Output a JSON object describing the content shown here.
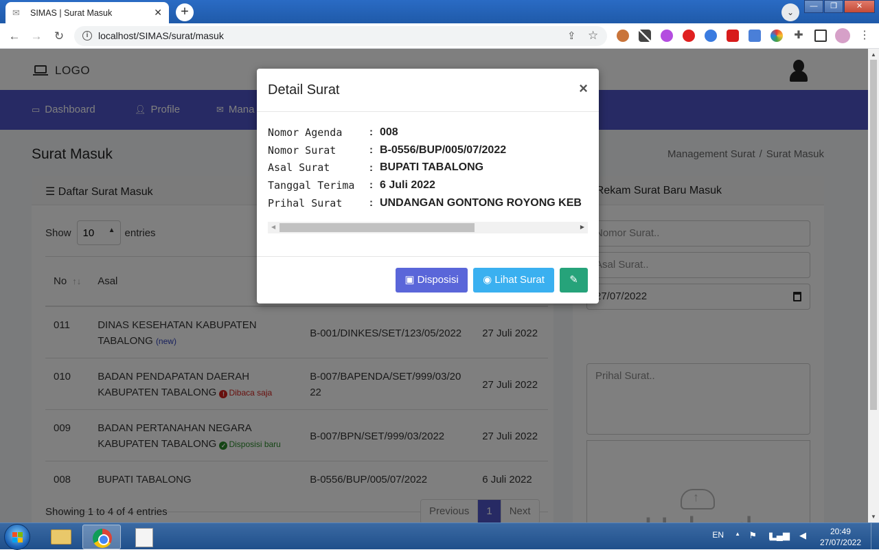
{
  "browser": {
    "tab_title": "SIMAS | Surat Masuk",
    "url": "localhost/SIMAS/surat/masuk",
    "new_tab_symbol": "+",
    "close_symbol": "✕"
  },
  "header": {
    "logo_text": "LOGO"
  },
  "nav": {
    "items": [
      {
        "label": "Dashboard",
        "icon": "monitor-icon"
      },
      {
        "label": "Profile",
        "icon": "user-icon"
      },
      {
        "label": "Mana",
        "icon": "mail-icon"
      }
    ]
  },
  "content": {
    "title": "Surat Masuk",
    "breadcrumb": [
      "Management Surat",
      "Surat Masuk"
    ]
  },
  "list_card": {
    "title": "Daftar Surat Masuk",
    "show_label": "Show",
    "entries_label": "entries",
    "page_size": "10",
    "columns": [
      "No",
      "Asal"
    ],
    "rows": [
      {
        "no": "011",
        "asal": "DINAS KESEHATAN KABUPATEN TABALONG",
        "badge": "(new)",
        "badge_type": "new",
        "nomor": "B-001/DINKES/SET/123/05/2022",
        "tanggal": "27 Juli 2022"
      },
      {
        "no": "010",
        "asal": "BADAN PENDAPATAN DAERAH KABUPATEN TABALONG",
        "badge": "Dibaca saja",
        "badge_type": "read",
        "nomor": "B-007/BAPENDA/SET/999/03/2022",
        "tanggal": "27 Juli 2022"
      },
      {
        "no": "009",
        "asal": "BADAN PERTANAHAN NEGARA KABUPATEN TABALONG",
        "badge": "Disposisi baru",
        "badge_type": "disposisi",
        "nomor": "B-007/BPN/SET/999/03/2022",
        "tanggal": "27 Juli 2022"
      },
      {
        "no": "008",
        "asal": "BUPATI TABALONG",
        "badge": "",
        "badge_type": "",
        "nomor": "B-0556/BUP/005/07/2022",
        "tanggal": "6 Juli 2022"
      }
    ],
    "showing": "Showing 1 to 4 of 4 entries",
    "pagination": {
      "previous": "Previous",
      "current": "1",
      "next": "Next"
    }
  },
  "form_card": {
    "title": "Rekam Surat Baru Masuk",
    "nomor_placeholder": "Nomor Surat..",
    "asal_placeholder": "Asal Surat..",
    "date_value": "27/07/2022",
    "prihal_placeholder": "Prihal Surat..",
    "upload_label": "Upload"
  },
  "modal": {
    "title": "Detail Surat",
    "close": "×",
    "fields": [
      {
        "label": "Nomor Agenda",
        "value": "008"
      },
      {
        "label": "Nomor Surat",
        "value": "B-0556/BUP/005/07/2022"
      },
      {
        "label": "Asal Surat",
        "value": "BUPATI TABALONG"
      },
      {
        "label": "Tanggal Terima",
        "value": "6 Juli 2022"
      },
      {
        "label": "Prihal Surat",
        "value": "UNDANGAN GONTONG ROYONG KEB"
      }
    ],
    "colon": ":",
    "buttons": {
      "disposisi": "Disposisi",
      "lihat": "Lihat Surat"
    }
  },
  "taskbar": {
    "lang": "EN",
    "time": "20:49",
    "date": "27/07/2022"
  },
  "colors": {
    "navbar": "#4e54c8",
    "btn_disposisi": "#5a66d9",
    "btn_lihat": "#3ab0f0",
    "btn_edit": "#26a37a",
    "badge_new": "#2c3fb8",
    "badge_read": "#d0211c",
    "badge_disposisi": "#2a8a2a"
  }
}
